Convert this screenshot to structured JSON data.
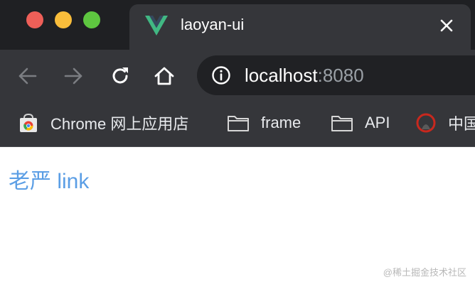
{
  "window": {
    "tab": {
      "title": "laoyan-ui",
      "favicon": "vue-logo-icon"
    }
  },
  "toolbar": {
    "url_host": "localhost",
    "url_port": ":8080"
  },
  "bookmarks": [
    {
      "label": "Chrome 网上应用店",
      "icon": "chrome-webstore-icon"
    },
    {
      "label": "frame",
      "icon": "folder-icon"
    },
    {
      "label": "API",
      "icon": "folder-icon"
    },
    {
      "label": "中国",
      "icon": "site-favicon-icon"
    }
  ],
  "page": {
    "link_text": "老严 link",
    "link_color": "#5b9ee5"
  },
  "watermark": "@稀土掘金技术社区",
  "colors": {
    "tabstrip_bg": "#1f2023",
    "toolbar_bg": "#35363a",
    "omnibox_bg": "#202124",
    "traffic_red": "#ee5f58",
    "traffic_yellow": "#f9bd3b",
    "traffic_green": "#5ec640"
  }
}
